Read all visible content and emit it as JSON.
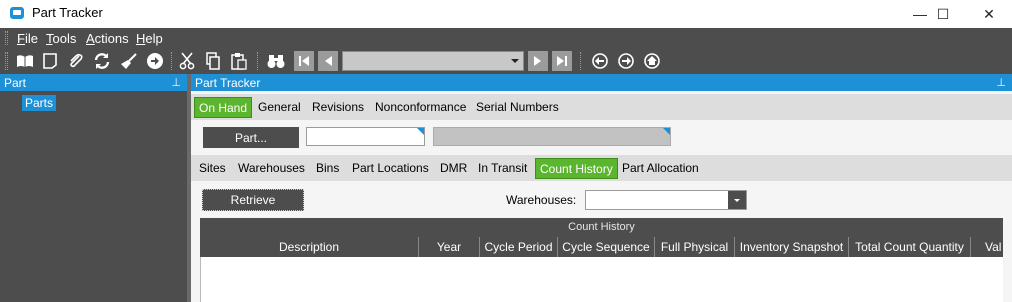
{
  "window": {
    "title": "Part Tracker",
    "minimize": "—",
    "maximize": "☐",
    "close": "✕"
  },
  "menu": [
    {
      "key": "F",
      "rest": "ile"
    },
    {
      "key": "T",
      "rest": "ools"
    },
    {
      "key": "A",
      "rest": "ctions"
    },
    {
      "key": "H",
      "rest": "elp"
    }
  ],
  "toolbar": {
    "icons": [
      "book-icon",
      "new-page-icon",
      "attach-icon",
      "refresh-icon",
      "clear-broom-icon",
      "forward-circle-icon",
      "cut-icon",
      "copy-icon",
      "paste-icon",
      "binoculars-icon"
    ],
    "nav_value": ""
  },
  "left_panel": {
    "title": "Part",
    "pin": "📌",
    "tree_item": "Parts"
  },
  "main_panel": {
    "title": "Part Tracker",
    "pin": "📌"
  },
  "top_tabs": [
    "On Hand",
    "General",
    "Revisions",
    "Nonconformance",
    "Serial Numbers"
  ],
  "part": {
    "button_label": "Part...",
    "part_value": "",
    "description_value": ""
  },
  "sub_tabs": [
    "Sites",
    "Warehouses",
    "Bins",
    "Part Locations",
    "DMR",
    "In Transit",
    "Count History",
    "Part Allocation"
  ],
  "retrieve_label": "Retrieve",
  "warehouses_label": "Warehouses:",
  "warehouses_value": "",
  "grid": {
    "title": "Count History",
    "columns": [
      "Description",
      "Year",
      "Cycle Period",
      "Cycle Sequence",
      "Full Physical",
      "Inventory Snapshot",
      "Total Count Quantity",
      "Val"
    ]
  },
  "colors": {
    "accent_blue": "#1e90d6",
    "tab_green": "#5bb52e",
    "dark_gray": "#4d4d4d"
  }
}
